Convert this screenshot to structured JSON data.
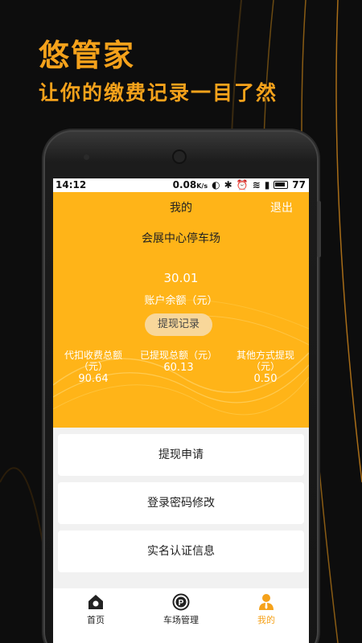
{
  "promo": {
    "title": "悠管家",
    "subtitle": "让你的缴费记录一目了然"
  },
  "status_bar": {
    "time": "14:12",
    "network_speed": "0.08",
    "network_unit": "K/s",
    "battery": "77"
  },
  "header": {
    "title": "我的",
    "logout_label": "退出"
  },
  "account": {
    "lot_name": "会展中心停车场",
    "balance": "30.01",
    "balance_label": "账户余额（元）",
    "record_button": "提现记录"
  },
  "stats": [
    {
      "label": "代扣收费总额（元）",
      "value": "90.64"
    },
    {
      "label": "已提现总额（元）",
      "value": "60.13"
    },
    {
      "label": "其他方式提现（元）",
      "value": "0.50"
    }
  ],
  "menu": [
    {
      "label": "提现申请"
    },
    {
      "label": "登录密码修改"
    },
    {
      "label": "实名认证信息"
    }
  ],
  "tabs": [
    {
      "label": "首页",
      "icon": "home-icon",
      "active": false
    },
    {
      "label": "车场管理",
      "icon": "parking-icon",
      "active": false
    },
    {
      "label": "我的",
      "icon": "person-icon",
      "active": true
    }
  ],
  "colors": {
    "accent": "#f5a21b",
    "hero": "#ffb418",
    "button": "#f8d79a"
  }
}
